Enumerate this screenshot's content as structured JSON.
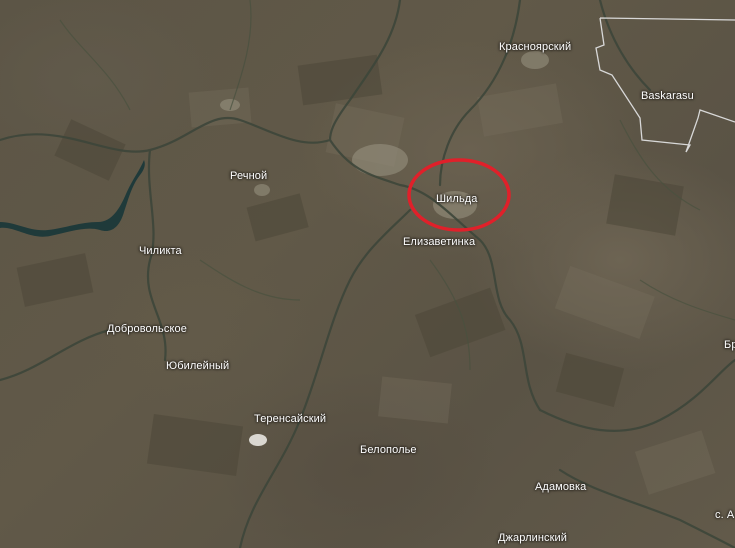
{
  "map": {
    "type": "satellite",
    "highlight": {
      "shape": "ellipse",
      "color": "#e0202a",
      "target": "Шильда"
    },
    "border_color": "#d8d8d8",
    "water_color": "#1f3a3a",
    "labels": {
      "krasnoyarsky": "Красноярский",
      "baskarasu": "Baskarasu",
      "rechnoy": "Речной",
      "shilda": "Шильда",
      "elizavetinka": "Елизаветинка",
      "chilikta": "Чиликта",
      "dobrovolskoe": "Добровольское",
      "yubileyny": "Юбилейный",
      "terensaysky": "Теренсайский",
      "belopolye": "Белополье",
      "adamovka": "Адамовка",
      "dzharlinsky": "Джарлинский",
      "edge_right_br": "Бр",
      "edge_right_sa": "с. А"
    }
  }
}
